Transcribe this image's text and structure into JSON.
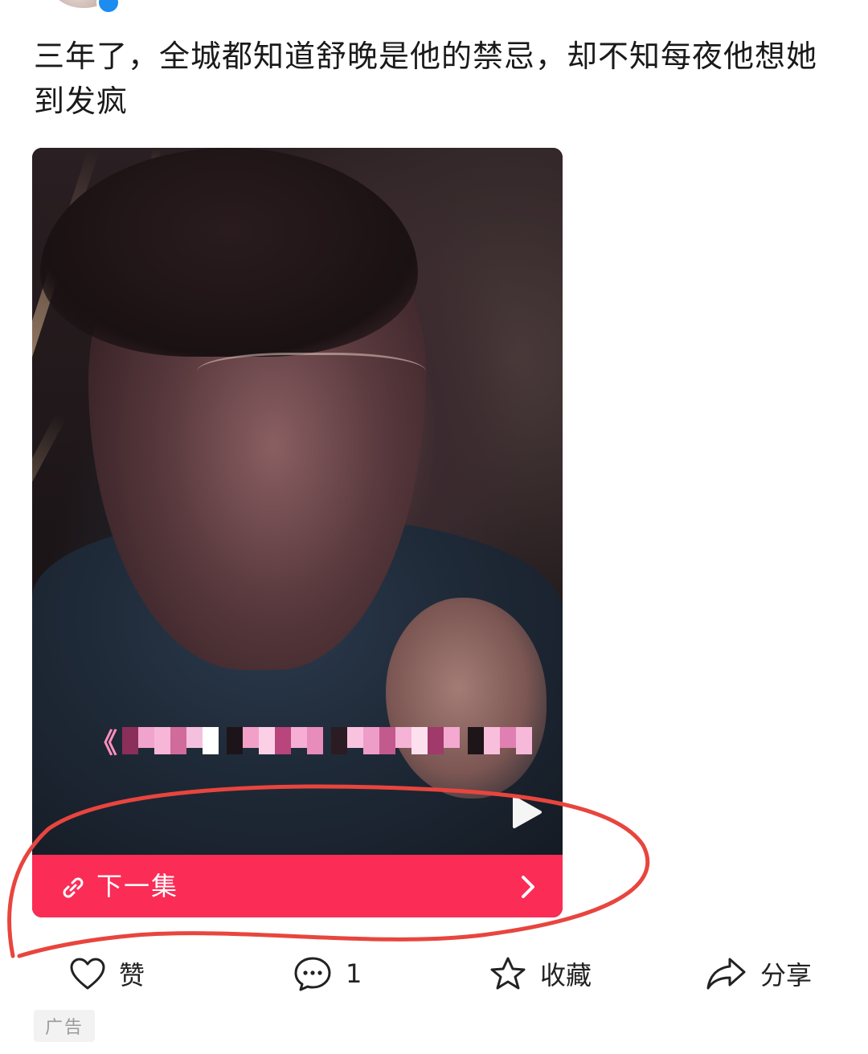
{
  "post": {
    "text": "三年了，全城都知道舒晚是他的禁忌，却不知每夜他想她到发疯"
  },
  "video": {
    "subtitle_prefix": "《",
    "subtitle_pixel_colors": [
      "#8a2f5a",
      "#f0a3cc",
      "#f7b6d8",
      "#d06b9c",
      "#f4c0de",
      "#ffffff",
      "#1c1418",
      "#f2a0c8",
      "#fbd0e6",
      "#b8457c",
      "#f6aed4",
      "#e88cbc",
      "#2a1c22",
      "#f9c3df",
      "#ee9dc8",
      "#c35a8e",
      "#f5b3d6",
      "#fde0ee",
      "#a03a6a",
      "#f3a9d0",
      "#1e1519",
      "#f8bedb",
      "#e07fb2",
      "#f7b9d9"
    ]
  },
  "cta": {
    "label": "下一集",
    "link_icon": "link-icon",
    "chevron_icon": "chevron-right-icon",
    "color": "#fb2c56"
  },
  "annotation": {
    "color": "#e8453e",
    "shape": "hand-drawn-ellipse"
  },
  "actions": {
    "like": {
      "label": "赞",
      "icon": "heart-icon"
    },
    "comment": {
      "label": "1",
      "icon": "comment-icon"
    },
    "favorite": {
      "label": "收藏",
      "icon": "star-icon"
    },
    "share": {
      "label": "分享",
      "icon": "share-icon"
    }
  },
  "ad_badge": {
    "label": "广告"
  }
}
